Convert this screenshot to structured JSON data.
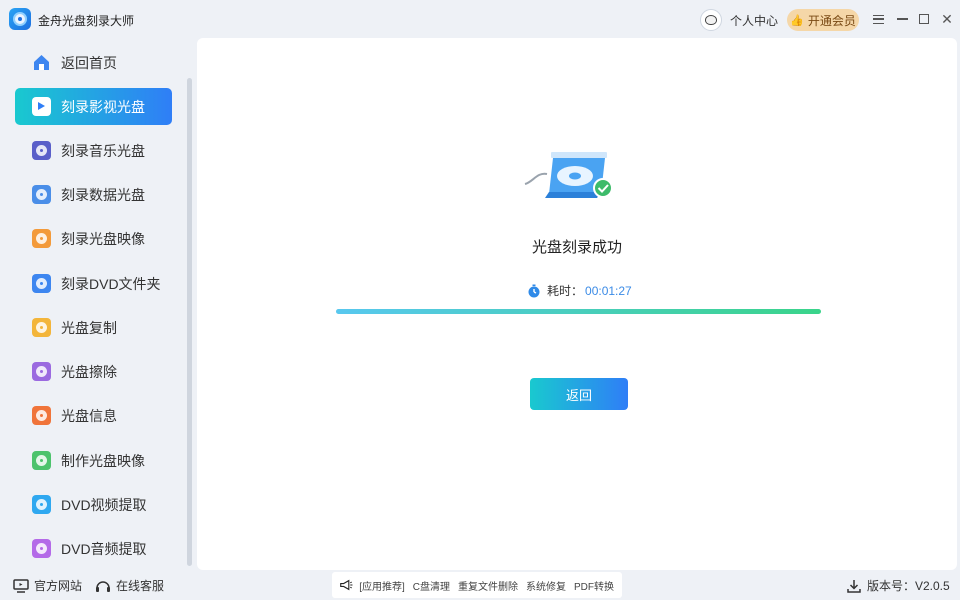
{
  "app": {
    "title": "金舟光盘刻录大师"
  },
  "header": {
    "user_center": "个人中心",
    "vip_button": "开通会员"
  },
  "sidebar": {
    "items": [
      {
        "label": "返回首页",
        "icon": "home-icon",
        "color": "#3d86f0",
        "active": false
      },
      {
        "label": "刻录影视光盘",
        "icon": "video-disc-icon",
        "color": "#2f7ef7",
        "active": true
      },
      {
        "label": "刻录音乐光盘",
        "icon": "music-disc-icon",
        "color": "#5a5fc9",
        "active": false
      },
      {
        "label": "刻录数据光盘",
        "icon": "data-disc-icon",
        "color": "#4a8ee8",
        "active": false
      },
      {
        "label": "刻录光盘映像",
        "icon": "disc-image-icon",
        "color": "#f39a3a",
        "active": false
      },
      {
        "label": "刻录DVD文件夹",
        "icon": "dvd-folder-icon",
        "color": "#3d86f0",
        "active": false
      },
      {
        "label": "光盘复制",
        "icon": "disc-copy-icon",
        "color": "#f3b53a",
        "active": false
      },
      {
        "label": "光盘擦除",
        "icon": "disc-erase-icon",
        "color": "#9b6ae0",
        "active": false
      },
      {
        "label": "光盘信息",
        "icon": "disc-info-icon",
        "color": "#f0743a",
        "active": false
      },
      {
        "label": "制作光盘映像",
        "icon": "make-image-icon",
        "color": "#4cc36c",
        "active": false
      },
      {
        "label": "DVD视频提取",
        "icon": "dvd-video-extract-icon",
        "color": "#2fa8f0",
        "active": false
      },
      {
        "label": "DVD音频提取",
        "icon": "dvd-audio-extract-icon",
        "color": "#b46ae8",
        "active": false
      }
    ]
  },
  "main": {
    "status_title": "光盘刻录成功",
    "time_label": "耗时：",
    "time_value": "00:01:27",
    "progress": 1.0,
    "back_button": "返回"
  },
  "footer": {
    "official_site": "官方网站",
    "online_service": "在线客服",
    "recommend_label": "[应用推荐]",
    "recommend_items": [
      "C盘清理",
      "重复文件删除",
      "系统修复",
      "PDF转换"
    ],
    "version_label": "版本号：V2.0.5"
  }
}
